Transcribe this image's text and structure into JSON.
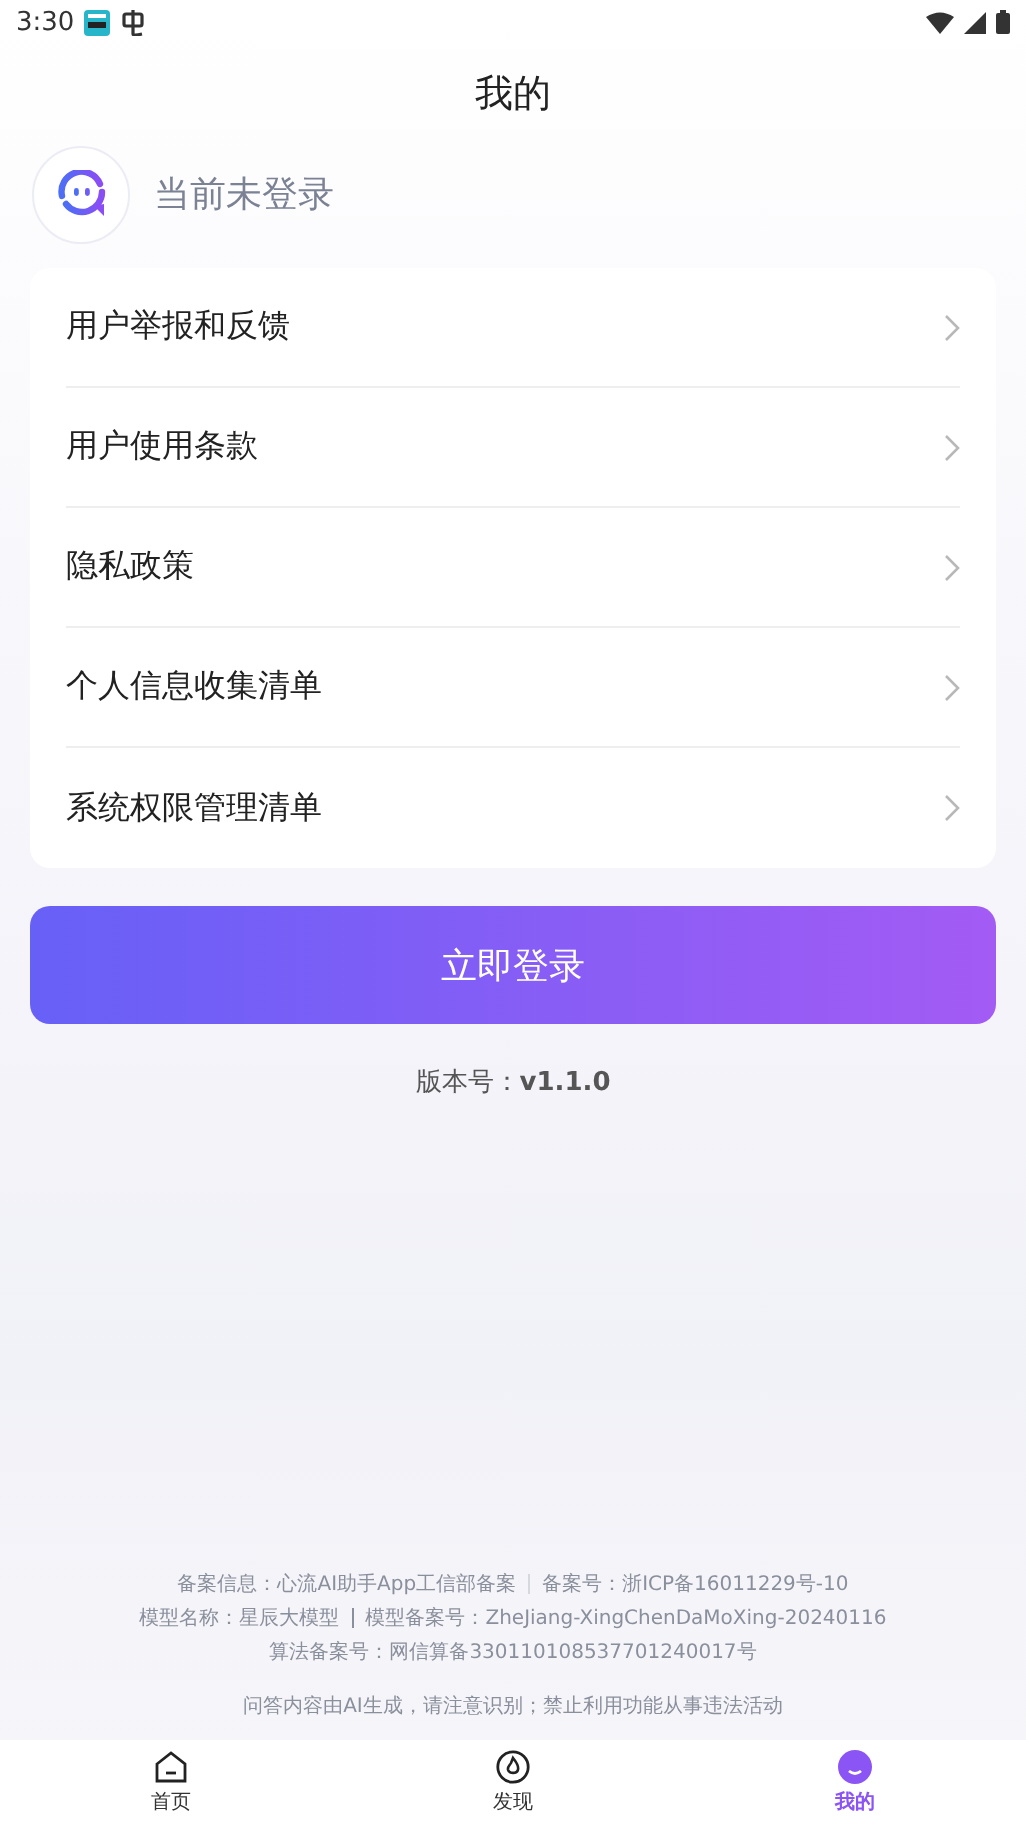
{
  "status_bar": {
    "time": "3:30"
  },
  "header": {
    "title": "我的"
  },
  "profile": {
    "status": "当前未登录"
  },
  "menu": [
    {
      "label": "用户举报和反馈"
    },
    {
      "label": "用户使用条款"
    },
    {
      "label": "隐私政策"
    },
    {
      "label": "个人信息收集清单"
    },
    {
      "label": "系统权限管理清单"
    }
  ],
  "login_button": {
    "label": "立即登录"
  },
  "version": {
    "label": "版本号：",
    "value": "v1.1.0"
  },
  "footer": {
    "lines": [
      [
        "备案信息：心流AI助手App工信部备案",
        "备案号：浙ICP备16011229号-10"
      ],
      [
        "模型名称：星辰大模型",
        "模型备案号：ZheJiang-XingChenDaMoXing-20240116"
      ],
      [
        "算法备案号：网信算备330110108537701240017号"
      ]
    ],
    "notice": "问答内容由AI生成，请注意识别；禁止利用功能从事违法活动"
  },
  "tab_bar": [
    {
      "kind": "home",
      "label": "首页",
      "selected": false
    },
    {
      "kind": "discover",
      "label": "发现",
      "selected": false
    },
    {
      "kind": "me",
      "label": "我的",
      "selected": true
    }
  ]
}
